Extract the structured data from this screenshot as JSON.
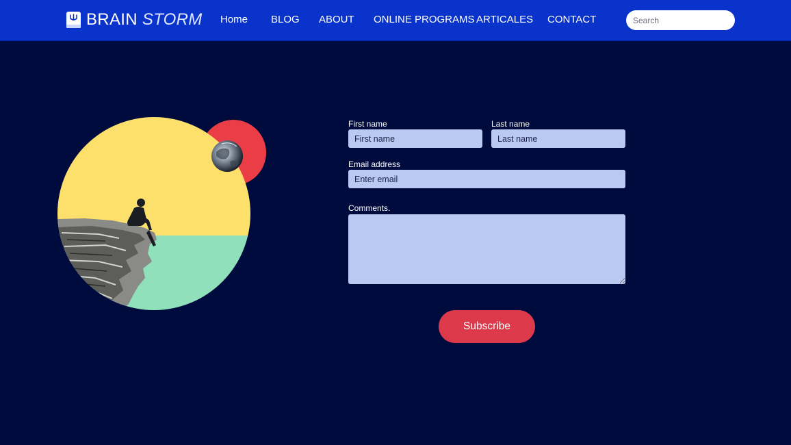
{
  "brand": {
    "name_regular": "BRAIN",
    "name_italic": "STORM",
    "icon": "book-logo-icon"
  },
  "nav": {
    "items": [
      {
        "label": "Home"
      },
      {
        "label": "BLOG"
      },
      {
        "label": "ABOUT"
      },
      {
        "label": "ONLINE PROGRAMS"
      },
      {
        "label": "ARTICALES"
      },
      {
        "label": "CONTACT"
      }
    ],
    "search_placeholder": "Search"
  },
  "form": {
    "first_name_label": "First name",
    "first_name_placeholder": "First name",
    "last_name_label": "Last name",
    "last_name_placeholder": "Last name",
    "email_label": "Email address",
    "email_placeholder": "Enter email",
    "comments_label": "Comments.",
    "subscribe_label": "Subscribe"
  },
  "colors": {
    "page_bg": "#000b3d",
    "navbar_bg": "#0a33cc",
    "field_bg": "#b9c9f2",
    "button_bg": "#dc3a4a",
    "circle_yellow": "#fde06b",
    "circle_green": "#8fe0bb",
    "circle_red": "#ea3d46"
  }
}
